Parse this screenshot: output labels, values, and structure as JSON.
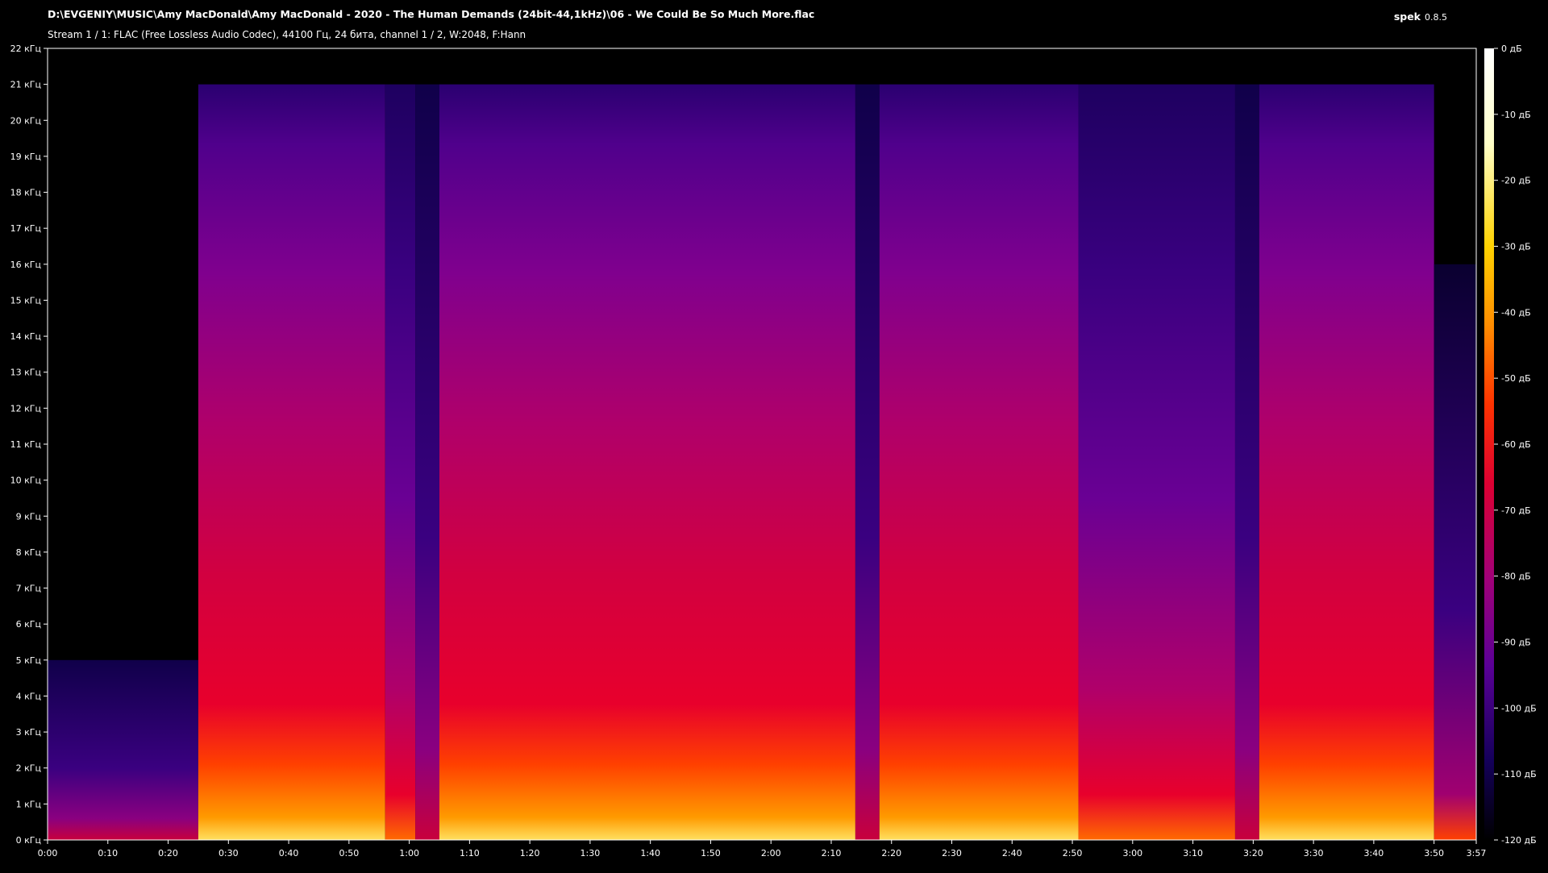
{
  "window": {
    "file_path": "D:\\EVGENIY\\MUSIC\\Amy MacDonald\\Amy MacDonald - 2020 - The Human Demands (24bit-44,1kHz)\\06 - We Could Be So Much More.flac",
    "stream_info": "Stream 1 / 1: FLAC (Free Lossless Audio Codec), 44100 Гц, 24 бита, channel 1 / 2, W:2048, F:Hann",
    "app_name": "spek",
    "app_version": "0.8.5"
  },
  "chart_data": {
    "type": "heatmap",
    "y_ticks": [
      "0 кГц",
      "1 кГц",
      "2 кГц",
      "3 кГц",
      "4 кГц",
      "5 кГц",
      "6 кГц",
      "7 кГц",
      "8 кГц",
      "9 кГц",
      "10 кГц",
      "11 кГц",
      "12 кГц",
      "13 кГц",
      "14 кГц",
      "15 кГц",
      "16 кГц",
      "17 кГц",
      "18 кГц",
      "19 кГц",
      "20 кГц",
      "21 кГц",
      "22 кГц"
    ],
    "ylim": [
      0,
      22
    ],
    "x_ticks": [
      "0:00",
      "0:10",
      "0:20",
      "0:30",
      "0:40",
      "0:50",
      "1:00",
      "1:10",
      "1:20",
      "1:30",
      "1:40",
      "1:50",
      "2:00",
      "2:10",
      "2:20",
      "2:30",
      "2:40",
      "2:50",
      "3:00",
      "3:10",
      "3:20",
      "3:30",
      "3:40",
      "3:50",
      "3:57"
    ],
    "x_tick_seconds": [
      0,
      10,
      20,
      30,
      40,
      50,
      60,
      70,
      80,
      90,
      100,
      110,
      120,
      130,
      140,
      150,
      160,
      170,
      180,
      190,
      200,
      210,
      220,
      230,
      237
    ],
    "xlim": [
      0,
      237
    ],
    "colorbar_ticks": [
      "0 дБ",
      "-10 дБ",
      "-20 дБ",
      "-30 дБ",
      "-40 дБ",
      "-50 дБ",
      "-60 дБ",
      "-70 дБ",
      "-80 дБ",
      "-90 дБ",
      "-100 дБ",
      "-110 дБ",
      "-120 дБ"
    ],
    "colorbar_range": [
      0,
      -120
    ],
    "colormap": [
      "#000000",
      "#14005a",
      "#5a0096",
      "#a00078",
      "#dc0032",
      "#ff3200",
      "#ff8c00",
      "#ffd200",
      "#ffffc8",
      "#ffffff"
    ],
    "segments": [
      {
        "t0": 0,
        "t1": 25,
        "fmax": 5,
        "level": "low"
      },
      {
        "t0": 25,
        "t1": 56,
        "fmax": 21,
        "level": "high"
      },
      {
        "t0": 56,
        "t1": 61,
        "fmax": 21,
        "level": "mid"
      },
      {
        "t0": 61,
        "t1": 65,
        "fmax": 21,
        "level": "low"
      },
      {
        "t0": 65,
        "t1": 134,
        "fmax": 21,
        "level": "high"
      },
      {
        "t0": 134,
        "t1": 138,
        "fmax": 21,
        "level": "low"
      },
      {
        "t0": 138,
        "t1": 171,
        "fmax": 21,
        "level": "high"
      },
      {
        "t0": 171,
        "t1": 197,
        "fmax": 21,
        "level": "mid"
      },
      {
        "t0": 197,
        "t1": 201,
        "fmax": 21,
        "level": "low"
      },
      {
        "t0": 201,
        "t1": 230,
        "fmax": 21,
        "level": "high"
      },
      {
        "t0": 230,
        "t1": 237,
        "fmax": 16,
        "level": "fade"
      }
    ]
  }
}
